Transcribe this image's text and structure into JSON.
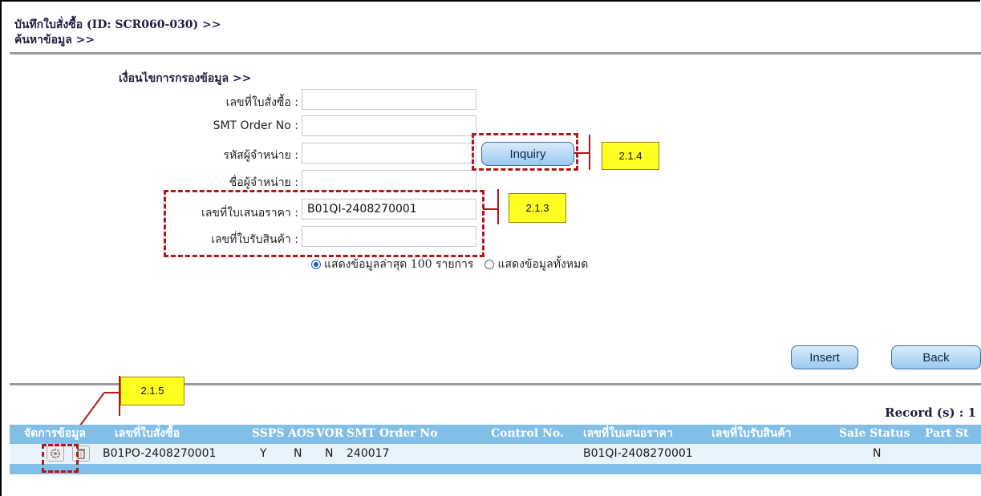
{
  "header": {
    "title": "บันทึกใบสั่งซื้อ (ID: SCR060-030) >>",
    "subtitle": "ค้นหาข้อมูล >>"
  },
  "filter": {
    "section_title": "เงื่อนไขการกรองข้อมูล >>",
    "fields": [
      {
        "label": "เลขที่ใบสั่งซื้อ :",
        "value": ""
      },
      {
        "label": "SMT Order No :",
        "value": ""
      },
      {
        "label": "รหัสผู้จำหน่าย :",
        "value": ""
      },
      {
        "label": "ชื่อผู้จำหน่าย :",
        "value": ""
      },
      {
        "label": "เลขที่ใบเสนอราคา :",
        "value": "B01QI-2408270001"
      },
      {
        "label": "เลขที่ใบรับสินค้า :",
        "value": ""
      }
    ],
    "inquiry_label": "Inquiry",
    "radio_latest": "แสดงข้อมูลล่าสุด 100 รายการ",
    "radio_all": "แสดงข้อมูลทั้งหมด",
    "selected_radio": "latest"
  },
  "actions": {
    "insert_label": "Insert",
    "back_label": "Back"
  },
  "annotations": {
    "tag_214": "2.1.4",
    "tag_213": "2.1.3",
    "tag_215": "2.1.5"
  },
  "table": {
    "record_count": "Record (s) : 1",
    "columns": [
      "จัดการข้อมูล",
      "เลขที่ใบสั่งซื้อ",
      "SSPS",
      "AOS",
      "VOR",
      "SMT Order No",
      "Control No.",
      "เลขที่ใบเสนอราคา",
      "เลขที่ใบรับสินค้า",
      "Sale Status",
      "Part St"
    ],
    "rows": [
      {
        "po_no": "B01PO-2408270001",
        "ssps": "Y",
        "aos": "N",
        "vor": "N",
        "smt_order": "240017",
        "control_no": "",
        "quote_no": "B01QI-2408270001",
        "receipt_no": "",
        "sale_status": "N",
        "part_status": ""
      }
    ],
    "icons": [
      "gear-icon",
      "trash-icon"
    ],
    "header_color": "#82bfe8",
    "row_color": "#e9f3fb"
  }
}
